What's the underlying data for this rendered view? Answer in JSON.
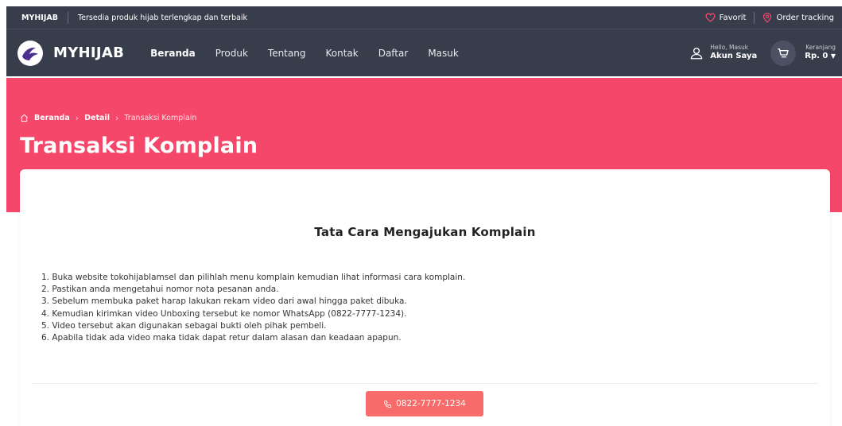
{
  "topbar": {
    "brand": "MYHIJAB",
    "tagline": "Tersedia produk hijab terlengkap dan terbaik",
    "favorite_label": "Favorit",
    "order_tracking_label": "Order tracking"
  },
  "navbar": {
    "logo_text": "MYHIJAB",
    "menu": [
      {
        "label": "Beranda",
        "active": true
      },
      {
        "label": "Produk"
      },
      {
        "label": "Tentang"
      },
      {
        "label": "Kontak"
      },
      {
        "label": "Daftar"
      },
      {
        "label": "Masuk"
      }
    ],
    "account": {
      "greeting": "Hello, Masuk",
      "label": "Akun Saya"
    },
    "cart": {
      "label": "Keranjang",
      "total": "Rp. 0"
    }
  },
  "breadcrumb": {
    "home": "Beranda",
    "detail": "Detail",
    "current": "Transaksi Komplain"
  },
  "page_title": "Transaksi Komplain",
  "card": {
    "title": "Tata Cara Mengajukan Komplain",
    "steps": [
      "1. Buka website tokohijablamsel dan pilihlah menu komplain kemudian lihat informasi cara komplain.",
      "2. Pastikan anda mengetahui nomor nota pesanan anda.",
      "3. Sebelum membuka paket harap lakukan rekam video dari awal hingga paket dibuka.",
      "4. Kemudian kirimkan video Unboxing tersebut ke nomor WhatsApp (0822-7777-1234).",
      "5. Video tersebut akan digunakan sebagai bukti oleh pihak pembeli.",
      "6. Apabila tidak ada video maka tidak dapat retur dalam alasan dan keadaan apapun."
    ],
    "whatsapp_button": "0822-7777-1234"
  },
  "colors": {
    "header_bg": "#383d4c",
    "hero_bg": "#f5476a",
    "accent_icon": "#f5476a",
    "button_bg": "#f76b6b"
  },
  "icons": [
    "heart-icon",
    "location-pin-icon",
    "logo-icon",
    "user-icon",
    "cart-icon",
    "caret-down-icon",
    "home-icon",
    "chevron-right-icon",
    "phone-icon"
  ]
}
